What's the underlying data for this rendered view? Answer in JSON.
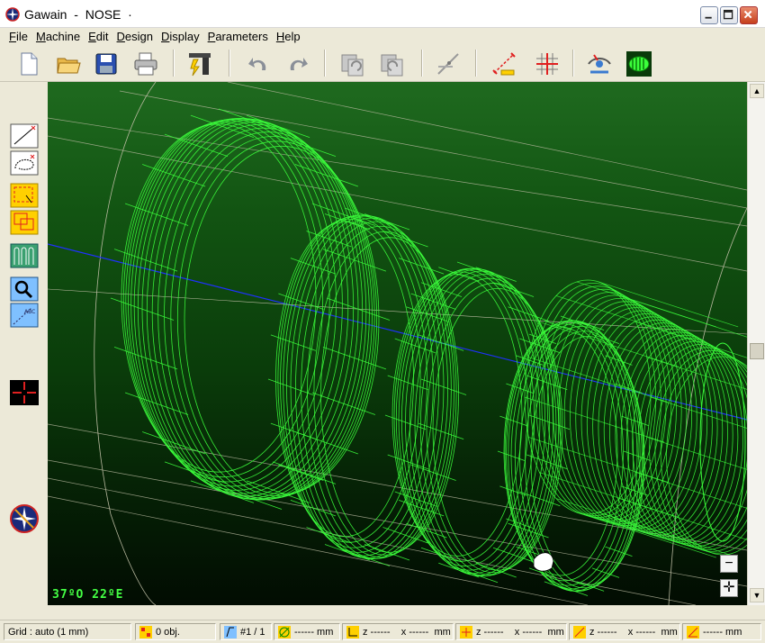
{
  "window": {
    "app_name": "Gawain",
    "separator": "-",
    "document": "NOSE",
    "modified_mark": "·"
  },
  "menu": [
    {
      "key": "F",
      "rest": "ile"
    },
    {
      "key": "M",
      "rest": "achine"
    },
    {
      "key": "E",
      "rest": "dit"
    },
    {
      "key": "D",
      "rest": "esign"
    },
    {
      "key": "D",
      "rest": "isplay"
    },
    {
      "key": "P",
      "rest": "arameters"
    },
    {
      "key": "H",
      "rest": "elp"
    }
  ],
  "toolbar": [
    "new-file",
    "open-folder",
    "save-disk",
    "print",
    "machine-tool",
    "undo",
    "redo",
    "copy-part",
    "paste-part",
    "measure-tool",
    "dimension-line",
    "grid-toggle",
    "view-eye",
    "render-shaded"
  ],
  "viewport": {
    "orientation_readout": "37°0  22°E",
    "orientation_text": "37ºO  22ºE",
    "zoom_out": "−",
    "zoom_in": "✛"
  },
  "status": {
    "grid": "Grid : auto  (1 mm)",
    "objects": "0 obj.",
    "page": "#1 / 1",
    "diameter": "------ mm",
    "z1": "z ------",
    "x1": "x ------",
    "mm1": "mm",
    "z2": "z ------",
    "x2": "x ------",
    "mm2": "mm",
    "z3": "z ------",
    "x3": "x ------",
    "mm3": "mm",
    "tail": "------ mm"
  },
  "colors": {
    "wire": "#3cff3c",
    "canvas_top": "#1f6a1f",
    "canvas_bottom": "#020c02",
    "axis_blue": "#2030ff",
    "stock_lines": "#b9b9a0"
  }
}
